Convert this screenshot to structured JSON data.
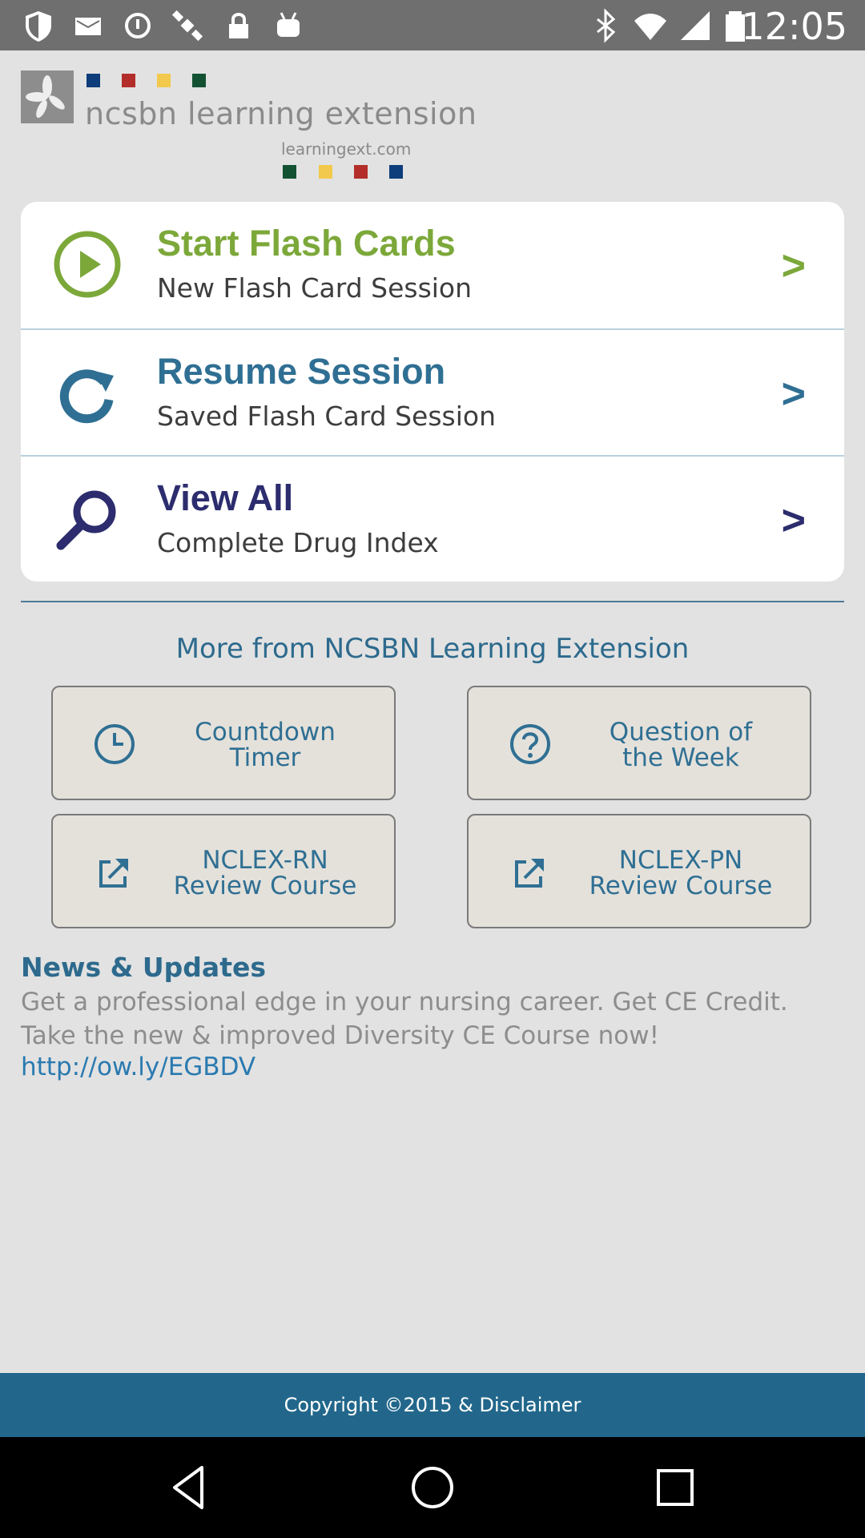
{
  "status_bar": {
    "time": "12:05",
    "icons": [
      "shield-icon",
      "mail-icon",
      "data-saver-icon",
      "satellite-icon",
      "lock-icon",
      "android-icon",
      "bluetooth-icon",
      "wifi-icon",
      "signal-icon",
      "battery-icon"
    ]
  },
  "logo": {
    "name": "ncsbn learning extension",
    "url": "learningext.com",
    "colors": [
      "#0d3d7a",
      "#b32e2a",
      "#f2c94c",
      "#125233"
    ]
  },
  "menu": [
    {
      "title": "Start Flash Cards",
      "subtitle": "New Flash Card Session",
      "arrow": ">",
      "icon": "play-circle-icon",
      "color": "#7ca83a"
    },
    {
      "title": "Resume Session",
      "subtitle": "Saved Flash Card Session",
      "arrow": ">",
      "icon": "refresh-icon",
      "color": "#2f6f93"
    },
    {
      "title": "View All",
      "subtitle": "Complete Drug Index",
      "arrow": ">",
      "icon": "search-icon",
      "color": "#2c2c6e"
    }
  ],
  "more": {
    "title": "More from NCSBN Learning Extension",
    "buttons": [
      {
        "label": "Countdown\nTimer",
        "icon": "clock-icon"
      },
      {
        "label": "Question of\nthe Week",
        "icon": "question-circle-icon"
      },
      {
        "label": "NCLEX-RN\nReview Course",
        "icon": "external-link-icon"
      },
      {
        "label": "NCLEX-PN\nReview Course",
        "icon": "external-link-icon"
      }
    ]
  },
  "news": {
    "title": "News & Updates",
    "body": "Get a professional edge in your nursing career. Get CE Credit. Take the new & improved Diversity CE Course now!",
    "link": "http://ow.ly/EGBDV"
  },
  "footer": {
    "text": "Copyright ©2015 & Disclaimer"
  },
  "nav": {
    "buttons": [
      "back-icon",
      "home-icon",
      "recents-icon"
    ]
  }
}
